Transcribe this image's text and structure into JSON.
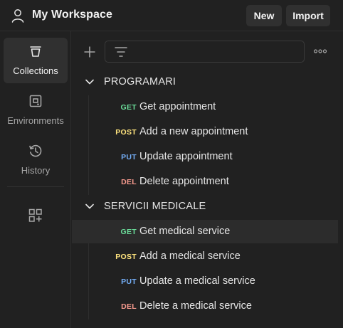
{
  "header": {
    "workspace_title": "My Workspace",
    "new_label": "New",
    "import_label": "Import"
  },
  "nav": {
    "items": [
      {
        "label": "Collections",
        "icon": "trash-can-collections-icon",
        "active": true
      },
      {
        "label": "Environments",
        "icon": "environment-icon",
        "active": false
      },
      {
        "label": "History",
        "icon": "history-clock-icon",
        "active": false
      }
    ],
    "configure_icon": "add-widgets-icon"
  },
  "toolbar": {
    "add_icon": "plus-icon",
    "filter_icon": "filter-lines-icon",
    "more_icon": "ellipsis-icon"
  },
  "collections": [
    {
      "name": "PROGRAMARI",
      "requests": [
        {
          "method": "GET",
          "name": "Get appointment"
        },
        {
          "method": "POST",
          "name": "Add a new appointment"
        },
        {
          "method": "PUT",
          "name": "Update appointment"
        },
        {
          "method": "DEL",
          "name": "Delete appointment"
        }
      ]
    },
    {
      "name": "SERVICII MEDICALE",
      "requests": [
        {
          "method": "GET",
          "name": "Get medical service"
        },
        {
          "method": "POST",
          "name": "Add a medical service"
        },
        {
          "method": "PUT",
          "name": "Update a medical service"
        },
        {
          "method": "DEL",
          "name": "Delete a medical service"
        }
      ]
    }
  ],
  "colors": {
    "GET": "#6bdd9a",
    "POST": "#ffe47e",
    "PUT": "#74aef6",
    "DEL": "#f79a8e",
    "background": "#212121",
    "highlight": "#2c2c2c"
  }
}
